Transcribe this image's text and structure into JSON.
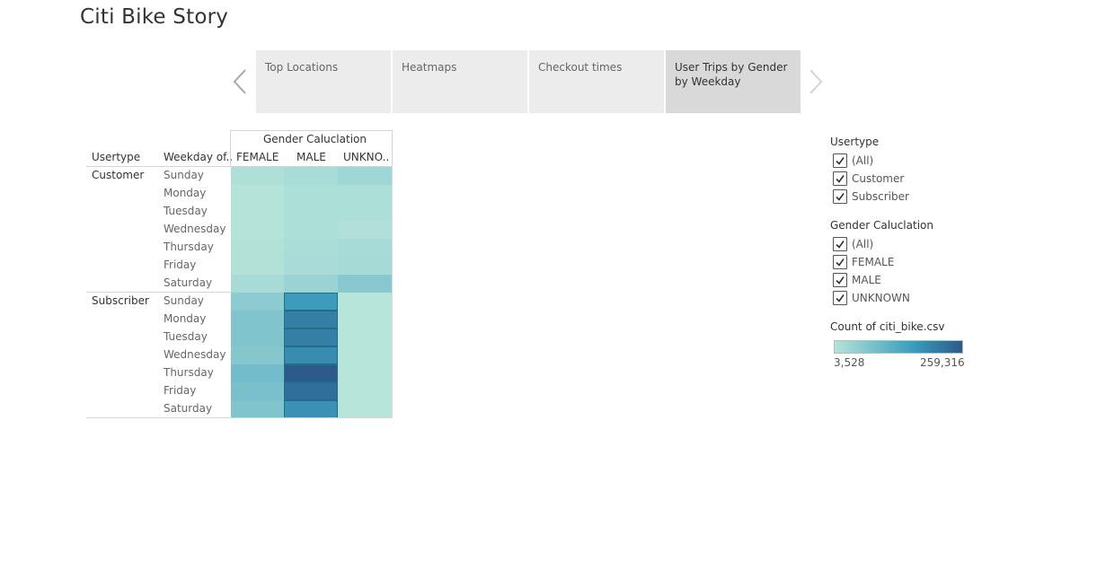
{
  "story": {
    "title": "Citi Bike Story"
  },
  "nav": {
    "prev_icon": "chevron-left-icon",
    "next_icon": "chevron-right-icon",
    "points": [
      {
        "label": "Top Locations",
        "active": false
      },
      {
        "label": "Heatmaps",
        "active": false
      },
      {
        "label": "Checkout times",
        "active": false
      },
      {
        "label": "User Trips by Gender by Weekday",
        "active": true
      }
    ]
  },
  "crosstab": {
    "column_group_header": "Gender Caluclation",
    "row_headers": [
      "Usertype",
      "Weekday of.."
    ],
    "columns": [
      "FEMALE",
      "MALE",
      "UNKNO.."
    ],
    "groups": [
      {
        "usertype": "Customer",
        "rows": [
          {
            "day": "Sunday",
            "colors": [
              "#afe0d7",
              "#a8dcd7",
              "#9fd6d6"
            ]
          },
          {
            "day": "Monday",
            "colors": [
              "#b4e3d9",
              "#addfd9",
              "#addfd9"
            ]
          },
          {
            "day": "Tuesday",
            "colors": [
              "#b4e3d9",
              "#addfd9",
              "#addfd9"
            ]
          },
          {
            "day": "Wednesday",
            "colors": [
              "#b4e3d9",
              "#addfd9",
              "#b0e0d9"
            ]
          },
          {
            "day": "Thursday",
            "colors": [
              "#b2e1d8",
              "#abddd8",
              "#a7dbd7"
            ]
          },
          {
            "day": "Friday",
            "colors": [
              "#b2e1d8",
              "#a9dcd8",
              "#a6dad7"
            ]
          },
          {
            "day": "Saturday",
            "colors": [
              "#a8dbd6",
              "#9bd3d5",
              "#88c9cf"
            ]
          }
        ]
      },
      {
        "usertype": "Subscriber",
        "rows": [
          {
            "day": "Sunday",
            "colors": [
              "#8ccbd0",
              "#3d9bbb",
              "#b8e5da"
            ]
          },
          {
            "day": "Monday",
            "colors": [
              "#80c4cd",
              "#357ea6",
              "#b8e5da"
            ]
          },
          {
            "day": "Tuesday",
            "colors": [
              "#80c4cd",
              "#357ea6",
              "#b8e5da"
            ]
          },
          {
            "day": "Wednesday",
            "colors": [
              "#86c7ce",
              "#388cb0",
              "#b8e5da"
            ]
          },
          {
            "day": "Thursday",
            "colors": [
              "#72bccb",
              "#2c5a8a",
              "#b8e5da"
            ]
          },
          {
            "day": "Friday",
            "colors": [
              "#79c0cc",
              "#306e9b",
              "#b8e5da"
            ]
          },
          {
            "day": "Saturday",
            "colors": [
              "#80c4cd",
              "#3a90b5",
              "#b8e5da"
            ]
          }
        ]
      }
    ]
  },
  "filters": {
    "usertype": {
      "title": "Usertype",
      "options": [
        "(All)",
        "Customer",
        "Subscriber"
      ]
    },
    "gender": {
      "title": "Gender Caluclation",
      "options": [
        "(All)",
        "FEMALE",
        "MALE",
        "UNKNOWN"
      ]
    },
    "check_icon": "checkmark-icon"
  },
  "color_legend": {
    "title": "Count of citi_bike.csv",
    "min_label": "3,528",
    "max_label": "259,316",
    "min_color": "#b4e3d9",
    "mid_color": "#3a9cbc",
    "max_color": "#2c5a8a"
  }
}
